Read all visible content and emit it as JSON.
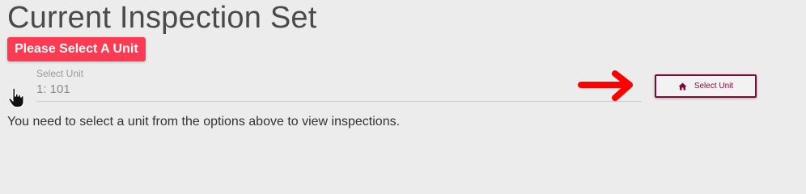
{
  "page": {
    "title": "Current Inspection Set"
  },
  "alert": {
    "text": "Please Select A Unit"
  },
  "unit_select": {
    "label": "Select Unit",
    "value": "1: 101"
  },
  "button": {
    "label": "Select Unit",
    "icon": "home-icon"
  },
  "info": {
    "text": "You need to select a unit from the options above to view inspections."
  },
  "colors": {
    "alert_bg": "#fc3a51",
    "button_accent": "#7b0a3b",
    "arrow": "#ff0000",
    "background": "#ececec"
  }
}
